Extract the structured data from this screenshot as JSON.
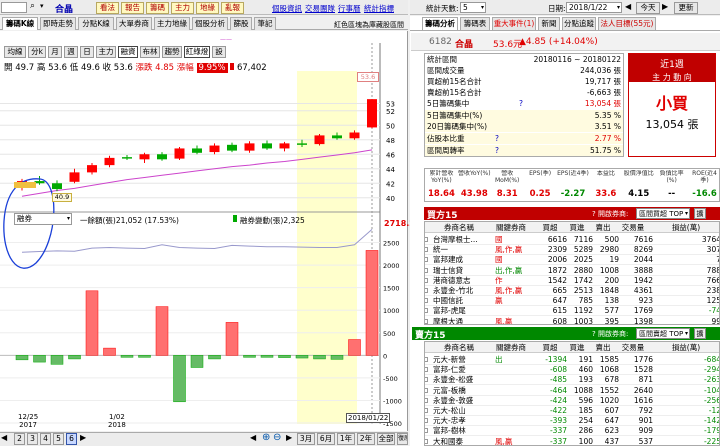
{
  "toolbar": {
    "stock": "合晶",
    "buttons": [
      "看法",
      "報告",
      "籌碼",
      "主力",
      "地緣",
      "亂報"
    ],
    "links": [
      "個股資訊",
      "交易團隊",
      "行事曆",
      "統計指標"
    ],
    "right": {
      "stat_label": "統計天數:",
      "stat_value": "5",
      "date_label": "日期:",
      "date_value": "2018/1/22",
      "today": "今天",
      "refresh": "更新"
    }
  },
  "left_tabs": [
    "籌碼K線",
    "即時走勢",
    "分點K線",
    "大單券商",
    "主力地緣",
    "個股分析",
    "篩股",
    "筆記"
  ],
  "left_note": "紅色區塊為庫藏股區間",
  "period_tabs": [
    "均線",
    "分k",
    "月",
    "週",
    "日",
    "主力",
    "融資",
    "布林",
    "趨勢",
    "紅綠燈",
    "設"
  ],
  "ohlc": {
    "open_label": "開",
    "open": "49.7",
    "high_label": "高",
    "high": "53.6",
    "low_label": "低",
    "low": "49.6",
    "close_label": "收",
    "close": "53.6",
    "chg_label": "漲跌",
    "chg": "4.85",
    "pct_label": "漲幅",
    "pct": "9.95%",
    "vol": "67,402"
  },
  "tiny_label": "——",
  "price_axis": [
    "53",
    "52",
    "50",
    "48",
    "46",
    "44",
    "42",
    "40"
  ],
  "price_tag_high": "53.6",
  "price_tag_low": "40.9",
  "indicator": {
    "select": "融券",
    "legend1": "一餘額(張)21,052 (17.53%)",
    "legend2": "融券變動(張)2,325",
    "value": "2718.2"
  },
  "vol_axis": [
    "2500",
    "2000",
    "1500",
    "1000",
    "500",
    "0",
    "-500",
    "-1000",
    "-1500"
  ],
  "dates": [
    {
      "md": "12/25",
      "y": "2017"
    },
    {
      "md": "1/02",
      "y": "2018"
    }
  ],
  "cursor_date": "2018/01/22",
  "bottom": {
    "pages": [
      "2",
      "3",
      "4",
      "5",
      "6"
    ],
    "active_page": "6",
    "ranges": [
      "3月",
      "6月",
      "1年",
      "2年",
      "全部"
    ],
    "fit": "復原"
  },
  "right_tabs": [
    "籌碼分析",
    "籌碼表",
    "重大事件(1)",
    "新聞",
    "分點追蹤",
    "法人目標(55元)"
  ],
  "quote": {
    "code": "6182",
    "name": "合晶",
    "price": "53.6元",
    "change": "▲4.85 (+14.04%)"
  },
  "stats": [
    {
      "label": "統計區間",
      "value": "20180116 ~ 20180122"
    },
    {
      "label": "區間成交量",
      "value": "244,036 張"
    },
    {
      "label": "買超前15名合計",
      "value": "19,717 張"
    },
    {
      "label": "賣超前15名合計",
      "value": "-6,663 張"
    },
    {
      "label": "5日籌碼集中",
      "value": "13,054 張"
    },
    {
      "label": "5日籌碼集中(%)",
      "value": "5.35 %"
    },
    {
      "label": "20日籌碼集中(%)",
      "value": "3.51 %"
    },
    {
      "label": "佔股本比重",
      "value": "2.77 %"
    },
    {
      "label": "區間周轉率",
      "value": "51.75 %"
    }
  ],
  "trend": {
    "title": "近1週",
    "subtitle": "主 力 動 向",
    "verdict": "小買",
    "amount": "13,054 張"
  },
  "metrics": {
    "headers": [
      "累計營收YoY(%)",
      "營收YoY(%)",
      "營收MoM(%)",
      "EPS(季)",
      "EPS(近4季)",
      "本益比",
      "股價淨值比",
      "負債比率(%)",
      "ROE(近4季)"
    ],
    "values": [
      "18.64",
      "43.98",
      "8.31",
      "0.25",
      "-2.27",
      "33.6",
      "4.15",
      "--",
      "-16.6"
    ]
  },
  "buy": {
    "title": "買方15",
    "hint": "? 開啟券商:",
    "select": "區間買超 TOP",
    "btn": "擴",
    "headers": [
      "券商名稱",
      "關鍵券商",
      "買超",
      "買進",
      "賣出",
      "交易量",
      "損益(萬)"
    ],
    "rows": [
      [
        "台灣摩根士...",
        "國",
        "6616",
        "7116",
        "500",
        "7616",
        "3764"
      ],
      [
        "統一",
        "風,作,贏",
        "2309",
        "5289",
        "2980",
        "8269",
        "307"
      ],
      [
        "富邦建成",
        "國",
        "2006",
        "2025",
        "19",
        "2044",
        "7"
      ],
      [
        "瑞士信貸",
        "出,作,贏",
        "1872",
        "2880",
        "1008",
        "3888",
        "788"
      ],
      [
        "港商德意志",
        "作",
        "1542",
        "1742",
        "200",
        "1942",
        "766"
      ],
      [
        "永豐金-竹北",
        "風,作,贏",
        "665",
        "2513",
        "1848",
        "4361",
        "238"
      ],
      [
        "中國信託",
        "贏",
        "647",
        "785",
        "138",
        "923",
        "125"
      ],
      [
        "富邦-虎尾",
        "",
        "615",
        "1192",
        "577",
        "1769",
        "-74"
      ],
      [
        "摩根大通",
        "風,贏",
        "608",
        "1003",
        "395",
        "1398",
        "99"
      ]
    ]
  },
  "sell": {
    "title": "賣方15",
    "hint": "? 開啟券商:",
    "select": "區間賣超 TOP",
    "btn": "擴",
    "headers": [
      "券商名稱",
      "關鍵券商",
      "買超",
      "買進",
      "賣出",
      "交易量",
      "損益(萬)"
    ],
    "rows": [
      [
        "元大-新營",
        "出",
        "-1394",
        "191",
        "1585",
        "1776",
        "-684"
      ],
      [
        "富邦-仁愛",
        "",
        "-608",
        "460",
        "1068",
        "1528",
        "-294"
      ],
      [
        "永豐金-松盛",
        "",
        "-485",
        "193",
        "678",
        "871",
        "-263"
      ],
      [
        "元富-板橋",
        "",
        "-464",
        "1088",
        "1552",
        "2640",
        "-104"
      ],
      [
        "永豐金-敦盛",
        "",
        "-424",
        "596",
        "1020",
        "1616",
        "-256"
      ],
      [
        "元大-松山",
        "",
        "-422",
        "185",
        "607",
        "792",
        "-12"
      ],
      [
        "元大-忠孝",
        "",
        "-393",
        "254",
        "647",
        "901",
        "-142"
      ],
      [
        "富邦-樹林",
        "",
        "-337",
        "286",
        "623",
        "909",
        "-179"
      ],
      [
        "大和國泰",
        "風,贏",
        "-337",
        "100",
        "437",
        "537",
        "-225"
      ]
    ]
  },
  "colors": {
    "up": "#ff0000",
    "down": "#00aa00",
    "accent": "#cc0000",
    "header_bg": "#c00000",
    "sell_bg": "#008800"
  },
  "chart_data": [
    {
      "type": "candlestick",
      "ylim": [
        39,
        55
      ],
      "y_ticks": [
        40,
        42,
        44,
        46,
        48,
        50,
        52,
        53
      ],
      "x_ticks": [
        "12/25",
        "1/02"
      ],
      "candles": [
        [
          41.5,
          42.6,
          41.0,
          42.3
        ],
        [
          42.3,
          43.0,
          41.8,
          42.0
        ],
        [
          42.0,
          42.4,
          40.9,
          41.2
        ],
        [
          42.2,
          44.0,
          42.0,
          43.5
        ],
        [
          43.5,
          44.8,
          43.2,
          44.5
        ],
        [
          44.5,
          45.8,
          44.2,
          45.5
        ],
        [
          45.6,
          45.9,
          45.2,
          45.4
        ],
        [
          45.3,
          46.2,
          44.8,
          46.0
        ],
        [
          46.0,
          46.3,
          45.1,
          45.3
        ],
        [
          45.4,
          47.0,
          45.2,
          46.8
        ],
        [
          46.8,
          47.2,
          46.0,
          46.2
        ],
        [
          46.3,
          47.5,
          46.0,
          47.2
        ],
        [
          47.3,
          47.6,
          46.3,
          46.5
        ],
        [
          46.5,
          47.8,
          46.2,
          47.5
        ],
        [
          47.5,
          47.9,
          46.6,
          46.8
        ],
        [
          46.8,
          47.7,
          46.4,
          47.5
        ],
        [
          47.5,
          48.0,
          47.0,
          47.3
        ],
        [
          47.4,
          48.8,
          47.2,
          48.6
        ],
        [
          48.6,
          49.0,
          48.0,
          48.2
        ],
        [
          48.2,
          49.3,
          48.0,
          49.0
        ],
        [
          49.7,
          53.6,
          49.6,
          53.6
        ]
      ],
      "ma": [
        40.2,
        40.6,
        41.0,
        41.3,
        41.7,
        42.1,
        42.5,
        42.8,
        43.1,
        43.4,
        43.7,
        44.0,
        44.3,
        44.5,
        44.8,
        45.0,
        45.3,
        45.6,
        45.9,
        46.2,
        46.6
      ]
    },
    {
      "type": "bar",
      "ylim": [
        -1500,
        2800
      ],
      "values": [
        -100,
        -150,
        -200,
        -80,
        1430,
        160,
        -40,
        -20,
        1080,
        -1030,
        -270,
        -80,
        730,
        -20,
        -30,
        -50,
        -60,
        -80,
        -90,
        350,
        2325
      ],
      "line": [
        17700,
        17800,
        17900,
        17850,
        18300,
        18400,
        18300,
        18250,
        18800,
        18400,
        18300,
        18250,
        18700,
        18600,
        18500,
        18500,
        18450,
        18400,
        18400,
        18800,
        21052
      ]
    }
  ]
}
